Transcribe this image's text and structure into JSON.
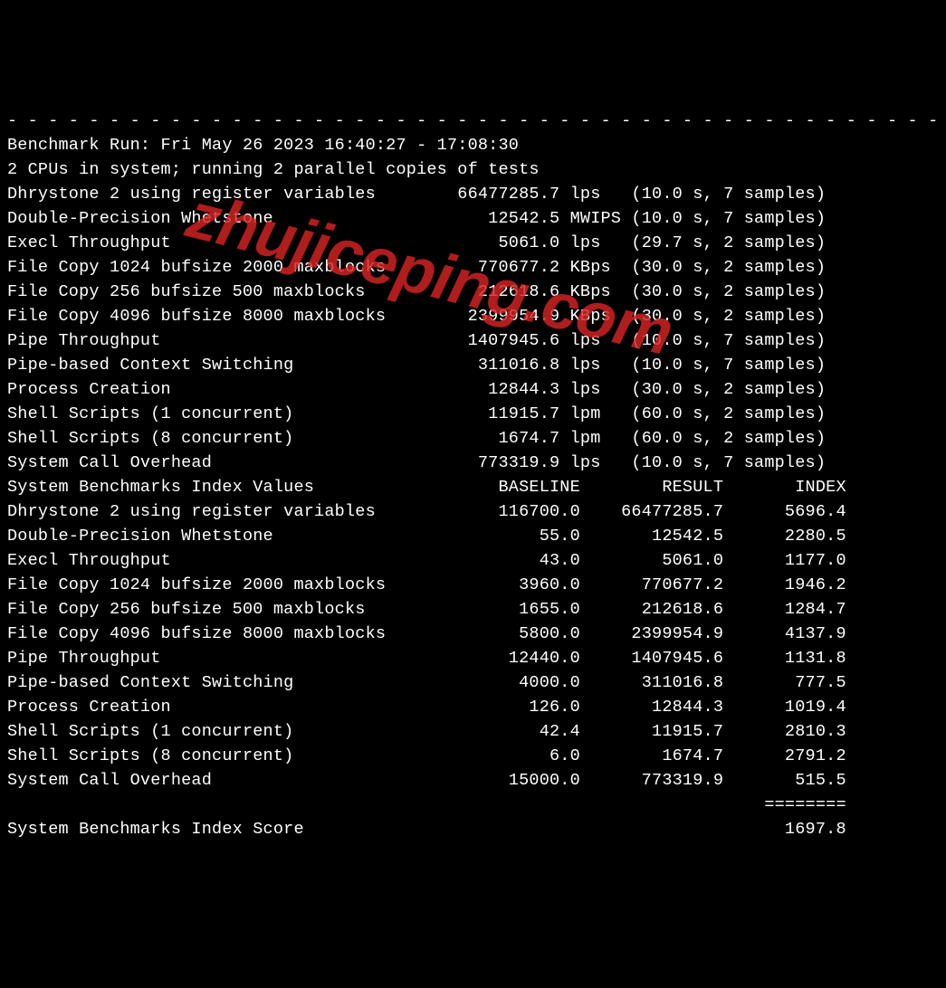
{
  "divider": "- - - - - - - - - - - - - - - - - - - - - - - - - - - - - - - - - - - - - - - - - - - - - - -",
  "header": {
    "run": "Benchmark Run: Fri May 26 2023 16:40:27 - 17:08:30",
    "cpus": "2 CPUs in system; running 2 parallel copies of tests"
  },
  "results": [
    {
      "name": "Dhrystone 2 using register variables",
      "value": "66477285.7",
      "unit": "lps",
      "meta": "(10.0 s, 7 samples)"
    },
    {
      "name": "Double-Precision Whetstone",
      "value": "12542.5",
      "unit": "MWIPS",
      "meta": "(10.0 s, 7 samples)"
    },
    {
      "name": "Execl Throughput",
      "value": "5061.0",
      "unit": "lps",
      "meta": "(29.7 s, 2 samples)"
    },
    {
      "name": "File Copy 1024 bufsize 2000 maxblocks",
      "value": "770677.2",
      "unit": "KBps",
      "meta": "(30.0 s, 2 samples)"
    },
    {
      "name": "File Copy 256 bufsize 500 maxblocks",
      "value": "212618.6",
      "unit": "KBps",
      "meta": "(30.0 s, 2 samples)"
    },
    {
      "name": "File Copy 4096 bufsize 8000 maxblocks",
      "value": "2399954.9",
      "unit": "KBps",
      "meta": "(30.0 s, 2 samples)"
    },
    {
      "name": "Pipe Throughput",
      "value": "1407945.6",
      "unit": "lps",
      "meta": "(10.0 s, 7 samples)"
    },
    {
      "name": "Pipe-based Context Switching",
      "value": "311016.8",
      "unit": "lps",
      "meta": "(10.0 s, 7 samples)"
    },
    {
      "name": "Process Creation",
      "value": "12844.3",
      "unit": "lps",
      "meta": "(30.0 s, 2 samples)"
    },
    {
      "name": "Shell Scripts (1 concurrent)",
      "value": "11915.7",
      "unit": "lpm",
      "meta": "(60.0 s, 2 samples)"
    },
    {
      "name": "Shell Scripts (8 concurrent)",
      "value": "1674.7",
      "unit": "lpm",
      "meta": "(60.0 s, 2 samples)"
    },
    {
      "name": "System Call Overhead",
      "value": "773319.9",
      "unit": "lps",
      "meta": "(10.0 s, 7 samples)"
    }
  ],
  "index_header": {
    "title": "System Benchmarks Index Values",
    "c1": "BASELINE",
    "c2": "RESULT",
    "c3": "INDEX"
  },
  "index": [
    {
      "name": "Dhrystone 2 using register variables",
      "baseline": "116700.0",
      "result": "66477285.7",
      "index": "5696.4"
    },
    {
      "name": "Double-Precision Whetstone",
      "baseline": "55.0",
      "result": "12542.5",
      "index": "2280.5"
    },
    {
      "name": "Execl Throughput",
      "baseline": "43.0",
      "result": "5061.0",
      "index": "1177.0"
    },
    {
      "name": "File Copy 1024 bufsize 2000 maxblocks",
      "baseline": "3960.0",
      "result": "770677.2",
      "index": "1946.2"
    },
    {
      "name": "File Copy 256 bufsize 500 maxblocks",
      "baseline": "1655.0",
      "result": "212618.6",
      "index": "1284.7"
    },
    {
      "name": "File Copy 4096 bufsize 8000 maxblocks",
      "baseline": "5800.0",
      "result": "2399954.9",
      "index": "4137.9"
    },
    {
      "name": "Pipe Throughput",
      "baseline": "12440.0",
      "result": "1407945.6",
      "index": "1131.8"
    },
    {
      "name": "Pipe-based Context Switching",
      "baseline": "4000.0",
      "result": "311016.8",
      "index": "777.5"
    },
    {
      "name": "Process Creation",
      "baseline": "126.0",
      "result": "12844.3",
      "index": "1019.4"
    },
    {
      "name": "Shell Scripts (1 concurrent)",
      "baseline": "42.4",
      "result": "11915.7",
      "index": "2810.3"
    },
    {
      "name": "Shell Scripts (8 concurrent)",
      "baseline": "6.0",
      "result": "1674.7",
      "index": "2791.2"
    },
    {
      "name": "System Call Overhead",
      "baseline": "15000.0",
      "result": "773319.9",
      "index": "515.5"
    }
  ],
  "score_rule": "                                                                          ========",
  "score": {
    "label": "System Benchmarks Index Score",
    "value": "1697.8"
  },
  "watermark": "zhujiceping.com"
}
